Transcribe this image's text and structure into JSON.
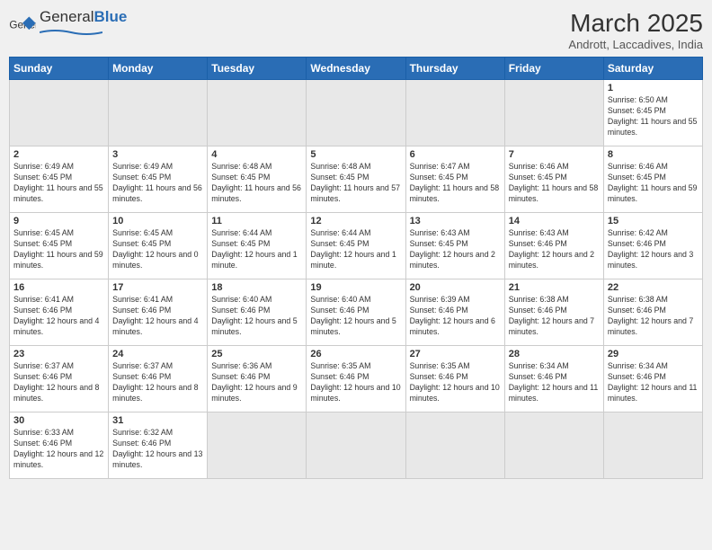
{
  "logo": {
    "text_general": "General",
    "text_blue": "Blue"
  },
  "header": {
    "title": "March 2025",
    "subtitle": "Andrott, Laccadives, India"
  },
  "weekdays": [
    "Sunday",
    "Monday",
    "Tuesday",
    "Wednesday",
    "Thursday",
    "Friday",
    "Saturday"
  ],
  "weeks": [
    [
      {
        "day": "",
        "empty": true
      },
      {
        "day": "",
        "empty": true
      },
      {
        "day": "",
        "empty": true
      },
      {
        "day": "",
        "empty": true
      },
      {
        "day": "",
        "empty": true
      },
      {
        "day": "",
        "empty": true
      },
      {
        "day": "1",
        "sunrise": "6:50 AM",
        "sunset": "6:45 PM",
        "daylight": "11 hours and 55 minutes."
      }
    ],
    [
      {
        "day": "2",
        "sunrise": "6:49 AM",
        "sunset": "6:45 PM",
        "daylight": "11 hours and 55 minutes."
      },
      {
        "day": "3",
        "sunrise": "6:49 AM",
        "sunset": "6:45 PM",
        "daylight": "11 hours and 56 minutes."
      },
      {
        "day": "4",
        "sunrise": "6:48 AM",
        "sunset": "6:45 PM",
        "daylight": "11 hours and 56 minutes."
      },
      {
        "day": "5",
        "sunrise": "6:48 AM",
        "sunset": "6:45 PM",
        "daylight": "11 hours and 57 minutes."
      },
      {
        "day": "6",
        "sunrise": "6:47 AM",
        "sunset": "6:45 PM",
        "daylight": "11 hours and 58 minutes."
      },
      {
        "day": "7",
        "sunrise": "6:46 AM",
        "sunset": "6:45 PM",
        "daylight": "11 hours and 58 minutes."
      },
      {
        "day": "8",
        "sunrise": "6:46 AM",
        "sunset": "6:45 PM",
        "daylight": "11 hours and 59 minutes."
      }
    ],
    [
      {
        "day": "9",
        "sunrise": "6:45 AM",
        "sunset": "6:45 PM",
        "daylight": "11 hours and 59 minutes."
      },
      {
        "day": "10",
        "sunrise": "6:45 AM",
        "sunset": "6:45 PM",
        "daylight": "12 hours and 0 minutes."
      },
      {
        "day": "11",
        "sunrise": "6:44 AM",
        "sunset": "6:45 PM",
        "daylight": "12 hours and 1 minute."
      },
      {
        "day": "12",
        "sunrise": "6:44 AM",
        "sunset": "6:45 PM",
        "daylight": "12 hours and 1 minute."
      },
      {
        "day": "13",
        "sunrise": "6:43 AM",
        "sunset": "6:45 PM",
        "daylight": "12 hours and 2 minutes."
      },
      {
        "day": "14",
        "sunrise": "6:43 AM",
        "sunset": "6:46 PM",
        "daylight": "12 hours and 2 minutes."
      },
      {
        "day": "15",
        "sunrise": "6:42 AM",
        "sunset": "6:46 PM",
        "daylight": "12 hours and 3 minutes."
      }
    ],
    [
      {
        "day": "16",
        "sunrise": "6:41 AM",
        "sunset": "6:46 PM",
        "daylight": "12 hours and 4 minutes."
      },
      {
        "day": "17",
        "sunrise": "6:41 AM",
        "sunset": "6:46 PM",
        "daylight": "12 hours and 4 minutes."
      },
      {
        "day": "18",
        "sunrise": "6:40 AM",
        "sunset": "6:46 PM",
        "daylight": "12 hours and 5 minutes."
      },
      {
        "day": "19",
        "sunrise": "6:40 AM",
        "sunset": "6:46 PM",
        "daylight": "12 hours and 5 minutes."
      },
      {
        "day": "20",
        "sunrise": "6:39 AM",
        "sunset": "6:46 PM",
        "daylight": "12 hours and 6 minutes."
      },
      {
        "day": "21",
        "sunrise": "6:38 AM",
        "sunset": "6:46 PM",
        "daylight": "12 hours and 7 minutes."
      },
      {
        "day": "22",
        "sunrise": "6:38 AM",
        "sunset": "6:46 PM",
        "daylight": "12 hours and 7 minutes."
      }
    ],
    [
      {
        "day": "23",
        "sunrise": "6:37 AM",
        "sunset": "6:46 PM",
        "daylight": "12 hours and 8 minutes."
      },
      {
        "day": "24",
        "sunrise": "6:37 AM",
        "sunset": "6:46 PM",
        "daylight": "12 hours and 8 minutes."
      },
      {
        "day": "25",
        "sunrise": "6:36 AM",
        "sunset": "6:46 PM",
        "daylight": "12 hours and 9 minutes."
      },
      {
        "day": "26",
        "sunrise": "6:35 AM",
        "sunset": "6:46 PM",
        "daylight": "12 hours and 10 minutes."
      },
      {
        "day": "27",
        "sunrise": "6:35 AM",
        "sunset": "6:46 PM",
        "daylight": "12 hours and 10 minutes."
      },
      {
        "day": "28",
        "sunrise": "6:34 AM",
        "sunset": "6:46 PM",
        "daylight": "12 hours and 11 minutes."
      },
      {
        "day": "29",
        "sunrise": "6:34 AM",
        "sunset": "6:46 PM",
        "daylight": "12 hours and 11 minutes."
      }
    ],
    [
      {
        "day": "30",
        "sunrise": "6:33 AM",
        "sunset": "6:46 PM",
        "daylight": "12 hours and 12 minutes."
      },
      {
        "day": "31",
        "sunrise": "6:32 AM",
        "sunset": "6:46 PM",
        "daylight": "12 hours and 13 minutes."
      },
      {
        "day": "",
        "empty": true
      },
      {
        "day": "",
        "empty": true
      },
      {
        "day": "",
        "empty": true
      },
      {
        "day": "",
        "empty": true
      },
      {
        "day": "",
        "empty": true
      }
    ]
  ]
}
